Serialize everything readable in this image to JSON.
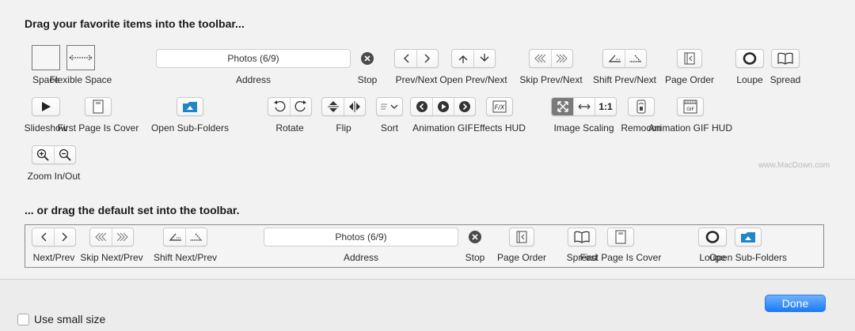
{
  "favorites_heading": "Drag your favorite items into the toolbar...",
  "default_heading": "... or drag the default set into the toolbar.",
  "favorites": {
    "space": "Space",
    "flexible_space": "Flexible Space",
    "address_value": "Photos (6/9)",
    "address": "Address",
    "stop": "Stop",
    "prev_next": "Prev/Next",
    "open_prev_next": "Open Prev/Next",
    "skip_prev_next": "Skip Prev/Next",
    "shift_prev_next": "Shift Prev/Next",
    "page_order": "Page Order",
    "loupe": "Loupe",
    "spread": "Spread",
    "slideshow": "Slideshow",
    "first_page_is_cover": "First Page Is Cover",
    "open_sub_folders": "Open Sub-Folders",
    "rotate": "Rotate",
    "flip": "Flip",
    "sort": "Sort",
    "animation_gif": "Animation GIF",
    "effects_hud": "Effects HUD",
    "image_scaling": "Image Scaling",
    "scaling_one_to_one": "1:1",
    "remocon": "Remocon",
    "animation_gif_hud": "Animation GIF HUD",
    "zoom_in_out": "Zoom In/Out"
  },
  "defaults": {
    "next_prev": "Next/Prev",
    "skip_next_prev": "Skip Next/Prev",
    "shift_next_prev": "Shift Next/Prev",
    "address_value": "Photos (6/9)",
    "address": "Address",
    "stop": "Stop",
    "page_order": "Page Order",
    "spread": "Spread",
    "first_page_is_cover": "First Page Is Cover",
    "loupe": "Loupe",
    "open_sub_folders": "Open Sub-Folders"
  },
  "watermark": "www.MacDown.com",
  "use_small_size": "Use small size",
  "done_button": "Done",
  "colors": {
    "accent": "#1a7cf5",
    "folder_icon": "#1f86c8"
  }
}
